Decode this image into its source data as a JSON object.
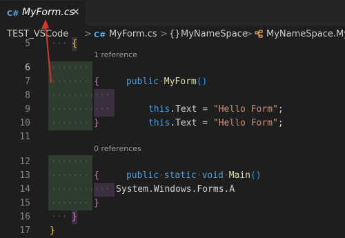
{
  "tab": {
    "lang": "C#",
    "title": "MyForm.cs",
    "close": "✕"
  },
  "breadcrumb": {
    "folder": "TEST_VSCode",
    "file_lang": "C#",
    "file": "MyForm.cs",
    "namespace_icon": "{}",
    "namespace": "MyNameSpace",
    "class_icon": "class-icon",
    "class": "MyNameSpace.My"
  },
  "editor": {
    "lenses": {
      "constructor": "1 reference",
      "main": "0 references"
    },
    "line_numbers": [
      "5",
      "6",
      "7",
      "8",
      "9",
      "10",
      "11",
      "12",
      "13",
      "14",
      "15",
      "16",
      "17"
    ],
    "active_line": "6",
    "code": {
      "l5_brace": "{",
      "l6_kw": "public",
      "l6_fn": "MyForm",
      "l6_parens": "()",
      "l7_brace": "{",
      "l8_this": "this",
      "l8_mid": ".Text = ",
      "l8_str": "\"Hello Form\"",
      "l8_end": ";",
      "l9_this": "this",
      "l9_mid": ".Text = ",
      "l9_str": "\"Hello Form\"",
      "l9_end": ";",
      "l10_brace": "}",
      "l12_kw1": "public",
      "l12_kw2": "static",
      "l12_kw3": "void",
      "l12_fn": "Main",
      "l12_parens": "()",
      "l13_brace": "{",
      "l14_text": "System.Windows.Forms.A",
      "l15_brace": "}",
      "l16_brace": "}",
      "l17_brace": "}"
    }
  },
  "colors": {
    "annotation_arrow": "#d9362b",
    "keyword": "#569cd6",
    "string": "#ce9178",
    "function": "#dcdcaa"
  }
}
